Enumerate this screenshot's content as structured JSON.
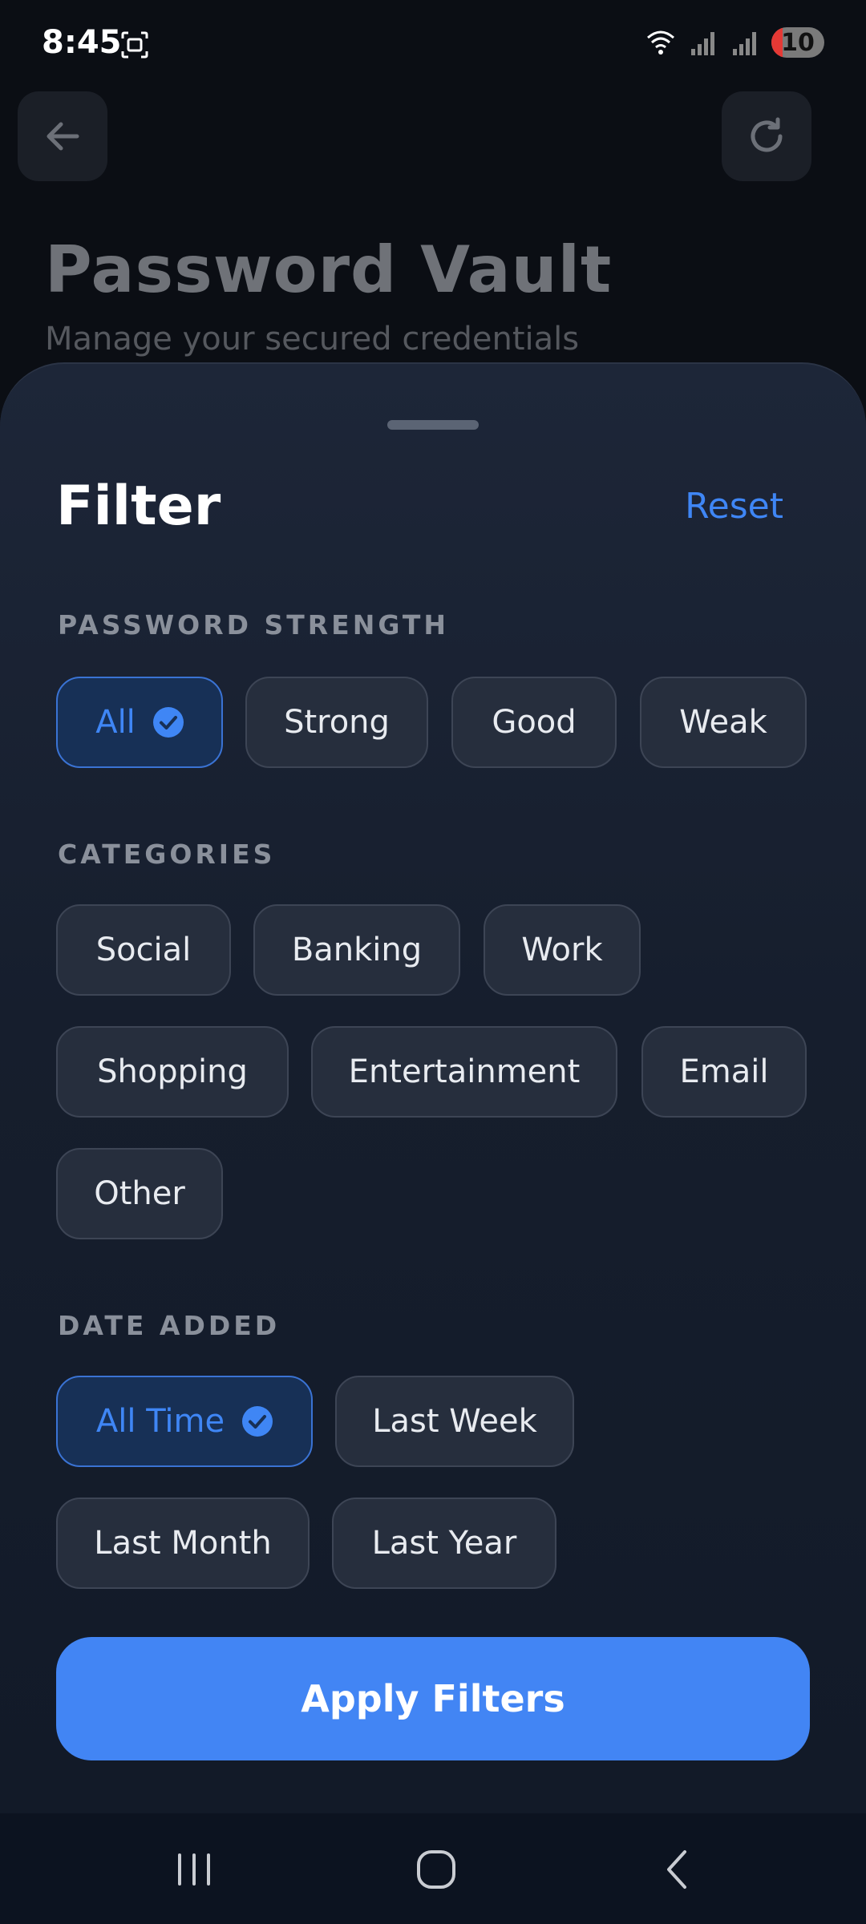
{
  "status_bar": {
    "time": "8:45",
    "battery": "10"
  },
  "background": {
    "title": "Password Vault",
    "subtitle": "Manage your secured credentials"
  },
  "sheet": {
    "title": "Filter",
    "reset_label": "Reset",
    "strength": {
      "label": "PASSWORD STRENGTH",
      "options": [
        "All",
        "Strong",
        "Good",
        "Weak"
      ],
      "selected": "All"
    },
    "categories": {
      "label": "CATEGORIES",
      "options": [
        "Social",
        "Banking",
        "Work",
        "Shopping",
        "Entertainment",
        "Email",
        "Other"
      ]
    },
    "date": {
      "label": "DATE ADDED",
      "options": [
        "All Time",
        "Last Week",
        "Last Month",
        "Last Year"
      ],
      "selected": "All Time"
    },
    "apply_label": "Apply Filters"
  },
  "colors": {
    "accent": "#4285f4",
    "selected_text": "#3f86f5",
    "sheet_bg": "#1d2638"
  }
}
